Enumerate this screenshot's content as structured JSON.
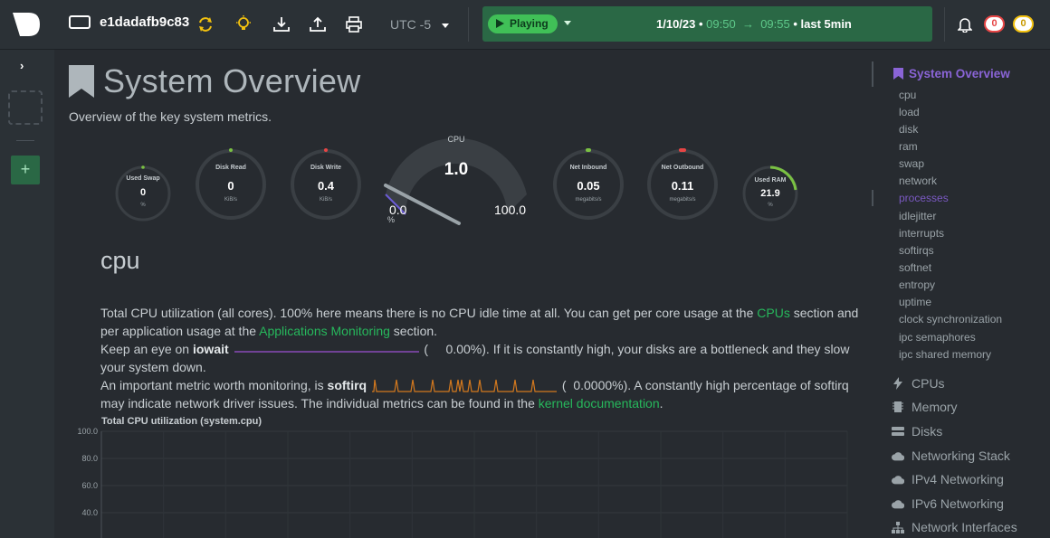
{
  "topbar": {
    "hostname": "e1dadafb9c83",
    "timezone": "UTC -5",
    "play_label": "Playing",
    "date": "1/10/23",
    "time_from": "09:50",
    "time_to": "09:55",
    "range_label": "last 5min",
    "alerts_critical": "0",
    "alerts_warning": "0"
  },
  "main": {
    "title": "System Overview",
    "subtitle": "Overview of the key system metrics.",
    "gauges": [
      {
        "label": "Used Swap",
        "value": "0",
        "unit": "%"
      },
      {
        "label": "Disk Read",
        "value": "0",
        "unit": "KiB/s"
      },
      {
        "label": "Disk Write",
        "value": "0.4",
        "unit": "KiB/s"
      },
      {
        "label": "Net Inbound",
        "value": "0.05",
        "unit": "megabits/s"
      },
      {
        "label": "Net Outbound",
        "value": "0.11",
        "unit": "megabits/s"
      },
      {
        "label": "Used RAM",
        "value": "21.9",
        "unit": "%"
      }
    ],
    "cpu_gauge": {
      "label": "CPU",
      "value": "1.0",
      "min": "0.0",
      "max": "100.0",
      "unit": "%"
    },
    "section_title": "cpu",
    "desc": {
      "p1a": "Total CPU utilization (all cores). 100% here means there is no CPU idle time at all. You can get per core usage at the ",
      "cpus_link": "CPUs",
      "p1b": " section and per application usage at the ",
      "apps_link": "Applications Monitoring",
      "p1c": " section.",
      "p2a": "Keep an eye on ",
      "iowait": "iowait",
      "iowait_val": "0.00%",
      "p2b": "). If it is constantly high, your disks are a bottleneck and they slow your system down.",
      "p3a": "An important metric worth monitoring, is ",
      "softirq": "softirq",
      "softirq_val": "0.0000%",
      "p3b": "). A constantly high percentage of softirq may indicate network driver issues. The individual metrics can be found in the ",
      "kernel_link": "kernel documentation",
      "p3c": "."
    },
    "chart_title": "Total CPU utilization (system.cpu)"
  },
  "chart_data": {
    "type": "line",
    "title": "Total CPU utilization (system.cpu)",
    "yticks": [
      "100.0",
      "80.0",
      "60.0",
      "40.0"
    ],
    "ylim": [
      0,
      100
    ],
    "grid": true
  },
  "nav": {
    "head": "System Overview",
    "sub": [
      "cpu",
      "load",
      "disk",
      "ram",
      "swap",
      "network",
      "processes",
      "idlejitter",
      "interrupts",
      "softirqs",
      "softnet",
      "entropy",
      "uptime",
      "clock synchronization",
      "ipc semaphores",
      "ipc shared memory"
    ],
    "main": [
      {
        "label": "CPUs",
        "icon": "bolt-icon"
      },
      {
        "label": "Memory",
        "icon": "memory-icon"
      },
      {
        "label": "Disks",
        "icon": "disk-icon"
      },
      {
        "label": "Networking Stack",
        "icon": "cloud-icon"
      },
      {
        "label": "IPv4 Networking",
        "icon": "cloud-icon"
      },
      {
        "label": "IPv6 Networking",
        "icon": "cloud-icon"
      },
      {
        "label": "Network Interfaces",
        "icon": "sitemap-icon"
      }
    ]
  },
  "colors": {
    "accent": "#27b85c",
    "nav_active": "#8a64d6",
    "play_bg": "#2a6845"
  }
}
